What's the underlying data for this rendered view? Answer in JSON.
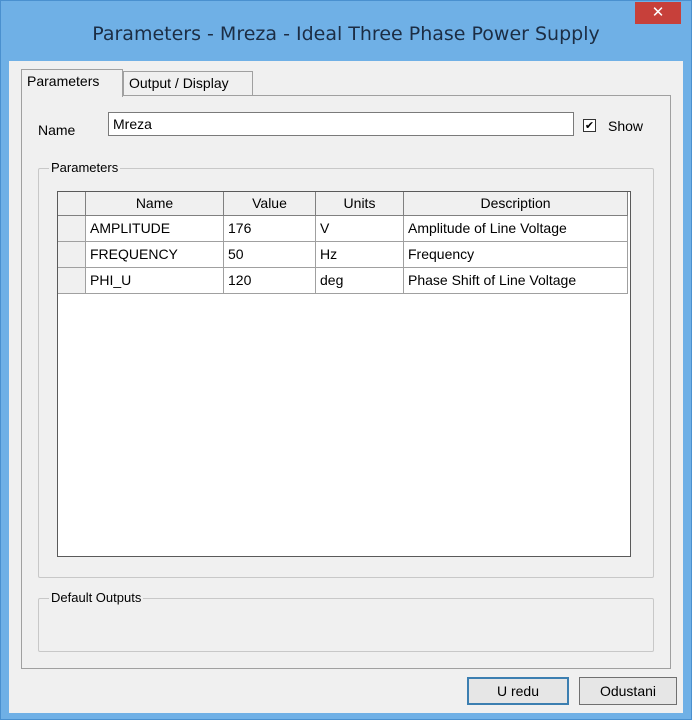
{
  "window": {
    "title": "Parameters - Mreza - Ideal Three Phase Power Supply",
    "close_glyph": "✕"
  },
  "tabs": [
    {
      "label": "Parameters",
      "active": true
    },
    {
      "label": "Output / Display",
      "active": false
    }
  ],
  "name_row": {
    "label": "Name",
    "value": "Mreza",
    "show_label": "Show",
    "show_checked": true,
    "check_glyph": "✔"
  },
  "parameters_group": {
    "legend": "Parameters",
    "columns": [
      "Name",
      "Value",
      "Units",
      "Description"
    ],
    "rows": [
      [
        "AMPLITUDE",
        "176",
        "V",
        "Amplitude of Line Voltage"
      ],
      [
        "FREQUENCY",
        "50",
        "Hz",
        "Frequency"
      ],
      [
        "PHI_U",
        "120",
        "deg",
        "Phase Shift of Line Voltage"
      ]
    ]
  },
  "default_outputs_group": {
    "legend": "Default Outputs"
  },
  "buttons": {
    "ok": "U redu",
    "cancel": "Odustani"
  }
}
